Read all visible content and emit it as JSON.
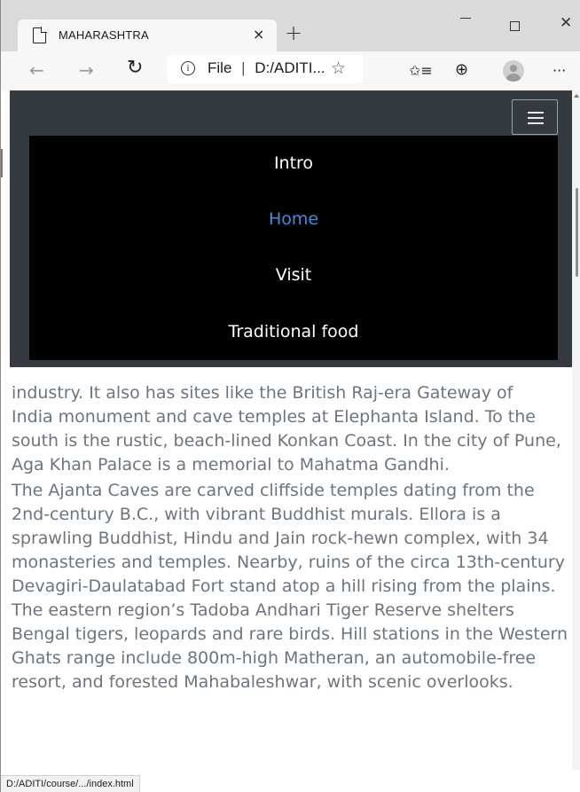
{
  "browser": {
    "tab_title": "MAHARASHTRA",
    "tab_close": "×",
    "new_tab": "+",
    "window_controls": {
      "minimize": "—",
      "maximize": "☐",
      "close": "✕"
    },
    "toolbar": {
      "back_icon": "←",
      "forward_icon": "→",
      "refresh_icon": "↻",
      "address_prefix": "File",
      "address_separator": "|",
      "address_text": "D:/ADITI...",
      "favorite_icon": "☆",
      "favorites_list_icon": "✩≡",
      "collections_icon": "⊕",
      "more_icon": "···"
    },
    "status_url": "D:/ADITI/course/.../index.html"
  },
  "nav": {
    "toggle_icon": "hamburger-icon",
    "menu_items": [
      {
        "label": "Intro",
        "active": false
      },
      {
        "label": "Home",
        "active": true
      },
      {
        "label": "Visit",
        "active": false
      },
      {
        "label": "Traditional food",
        "active": false
      }
    ]
  },
  "content": {
    "hidden_line": "industry. It also has sites like the British Raj-era Gateway of",
    "paragraph_1": "India monument and cave temples at Elephanta Island. To the south is the rustic, beach-lined Konkan Coast. In the city of Pune, Aga Khan Palace is a memorial to Mahatma Gandhi.",
    "paragraph_2": "The Ajanta Caves are carved cliffside temples dating from the 2nd-century B.C., with vibrant Buddhist murals. Ellora is a sprawling Buddhist, Hindu and Jain rock-hewn complex, with 34 monasteries and temples. Nearby, ruins of the circa 13th-century Devagiri-Daulatabad Fort stand atop a hill rising from the plains. The eastern region’s Tadoba Andhari Tiger Reserve shelters Bengal tigers, leopards and rare birds. Hill stations in the Western Ghats range include 800m-high Matheran, an automobile-free resort, and forested Mahabaleshwar, with scenic overlooks."
  },
  "colors": {
    "navbar_bg": "#343a40",
    "menu_bg": "#000000",
    "active_link": "#3d8fe0",
    "body_text": "#6c757d"
  }
}
